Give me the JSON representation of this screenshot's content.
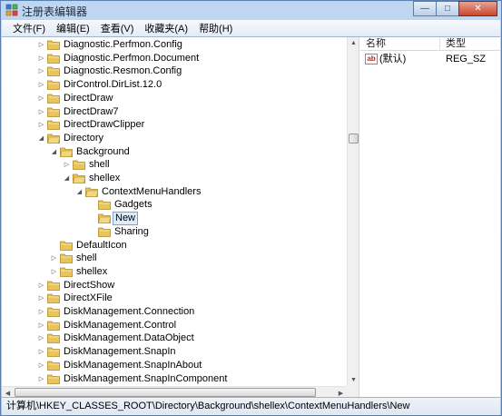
{
  "window": {
    "title": "注册表编辑器",
    "minimize_glyph": "—",
    "maximize_glyph": "□",
    "close_glyph": "✕"
  },
  "menu": [
    "文件(F)",
    "编辑(E)",
    "查看(V)",
    "收藏夹(A)",
    "帮助(H)"
  ],
  "tree": [
    {
      "label": "Diagnostic.Perfmon.Config",
      "level": 0,
      "expander": "collapsed"
    },
    {
      "label": "Diagnostic.Perfmon.Document",
      "level": 0,
      "expander": "collapsed"
    },
    {
      "label": "Diagnostic.Resmon.Config",
      "level": 0,
      "expander": "collapsed"
    },
    {
      "label": "DirControl.DirList.12.0",
      "level": 0,
      "expander": "collapsed"
    },
    {
      "label": "DirectDraw",
      "level": 0,
      "expander": "collapsed"
    },
    {
      "label": "DirectDraw7",
      "level": 0,
      "expander": "collapsed"
    },
    {
      "label": "DirectDrawClipper",
      "level": 0,
      "expander": "collapsed"
    },
    {
      "label": "Directory",
      "level": 0,
      "expander": "expanded"
    },
    {
      "label": "Background",
      "level": 1,
      "expander": "expanded"
    },
    {
      "label": "shell",
      "level": 2,
      "expander": "collapsed"
    },
    {
      "label": "shellex",
      "level": 2,
      "expander": "expanded"
    },
    {
      "label": "ContextMenuHandlers",
      "level": 3,
      "expander": "expanded"
    },
    {
      "label": "Gadgets",
      "level": 4,
      "expander": "none"
    },
    {
      "label": "New",
      "level": 4,
      "expander": "none",
      "selected": true
    },
    {
      "label": "Sharing",
      "level": 4,
      "expander": "none"
    },
    {
      "label": "DefaultIcon",
      "level": 1,
      "expander": "none"
    },
    {
      "label": "shell",
      "level": 1,
      "expander": "collapsed"
    },
    {
      "label": "shellex",
      "level": 1,
      "expander": "collapsed"
    },
    {
      "label": "DirectShow",
      "level": 0,
      "expander": "collapsed"
    },
    {
      "label": "DirectXFile",
      "level": 0,
      "expander": "collapsed"
    },
    {
      "label": "DiskManagement.Connection",
      "level": 0,
      "expander": "collapsed"
    },
    {
      "label": "DiskManagement.Control",
      "level": 0,
      "expander": "collapsed"
    },
    {
      "label": "DiskManagement.DataObject",
      "level": 0,
      "expander": "collapsed"
    },
    {
      "label": "DiskManagement.SnapIn",
      "level": 0,
      "expander": "collapsed"
    },
    {
      "label": "DiskManagement.SnapInAbout",
      "level": 0,
      "expander": "collapsed"
    },
    {
      "label": "DiskManagement.SnapInComponent",
      "level": 0,
      "expander": "collapsed"
    }
  ],
  "values_pane": {
    "col_name": "名称",
    "col_type": "类型",
    "rows": [
      {
        "icon": "ab",
        "name": "(默认)",
        "type": "REG_SZ"
      }
    ]
  },
  "status": "计算机\\HKEY_CLASSES_ROOT\\Directory\\Background\\shellex\\ContextMenuHandlers\\New",
  "colors": {
    "selection_bg": "#ddecfd",
    "selection_border": "#7da2ce",
    "folder": "#e8c45a"
  }
}
